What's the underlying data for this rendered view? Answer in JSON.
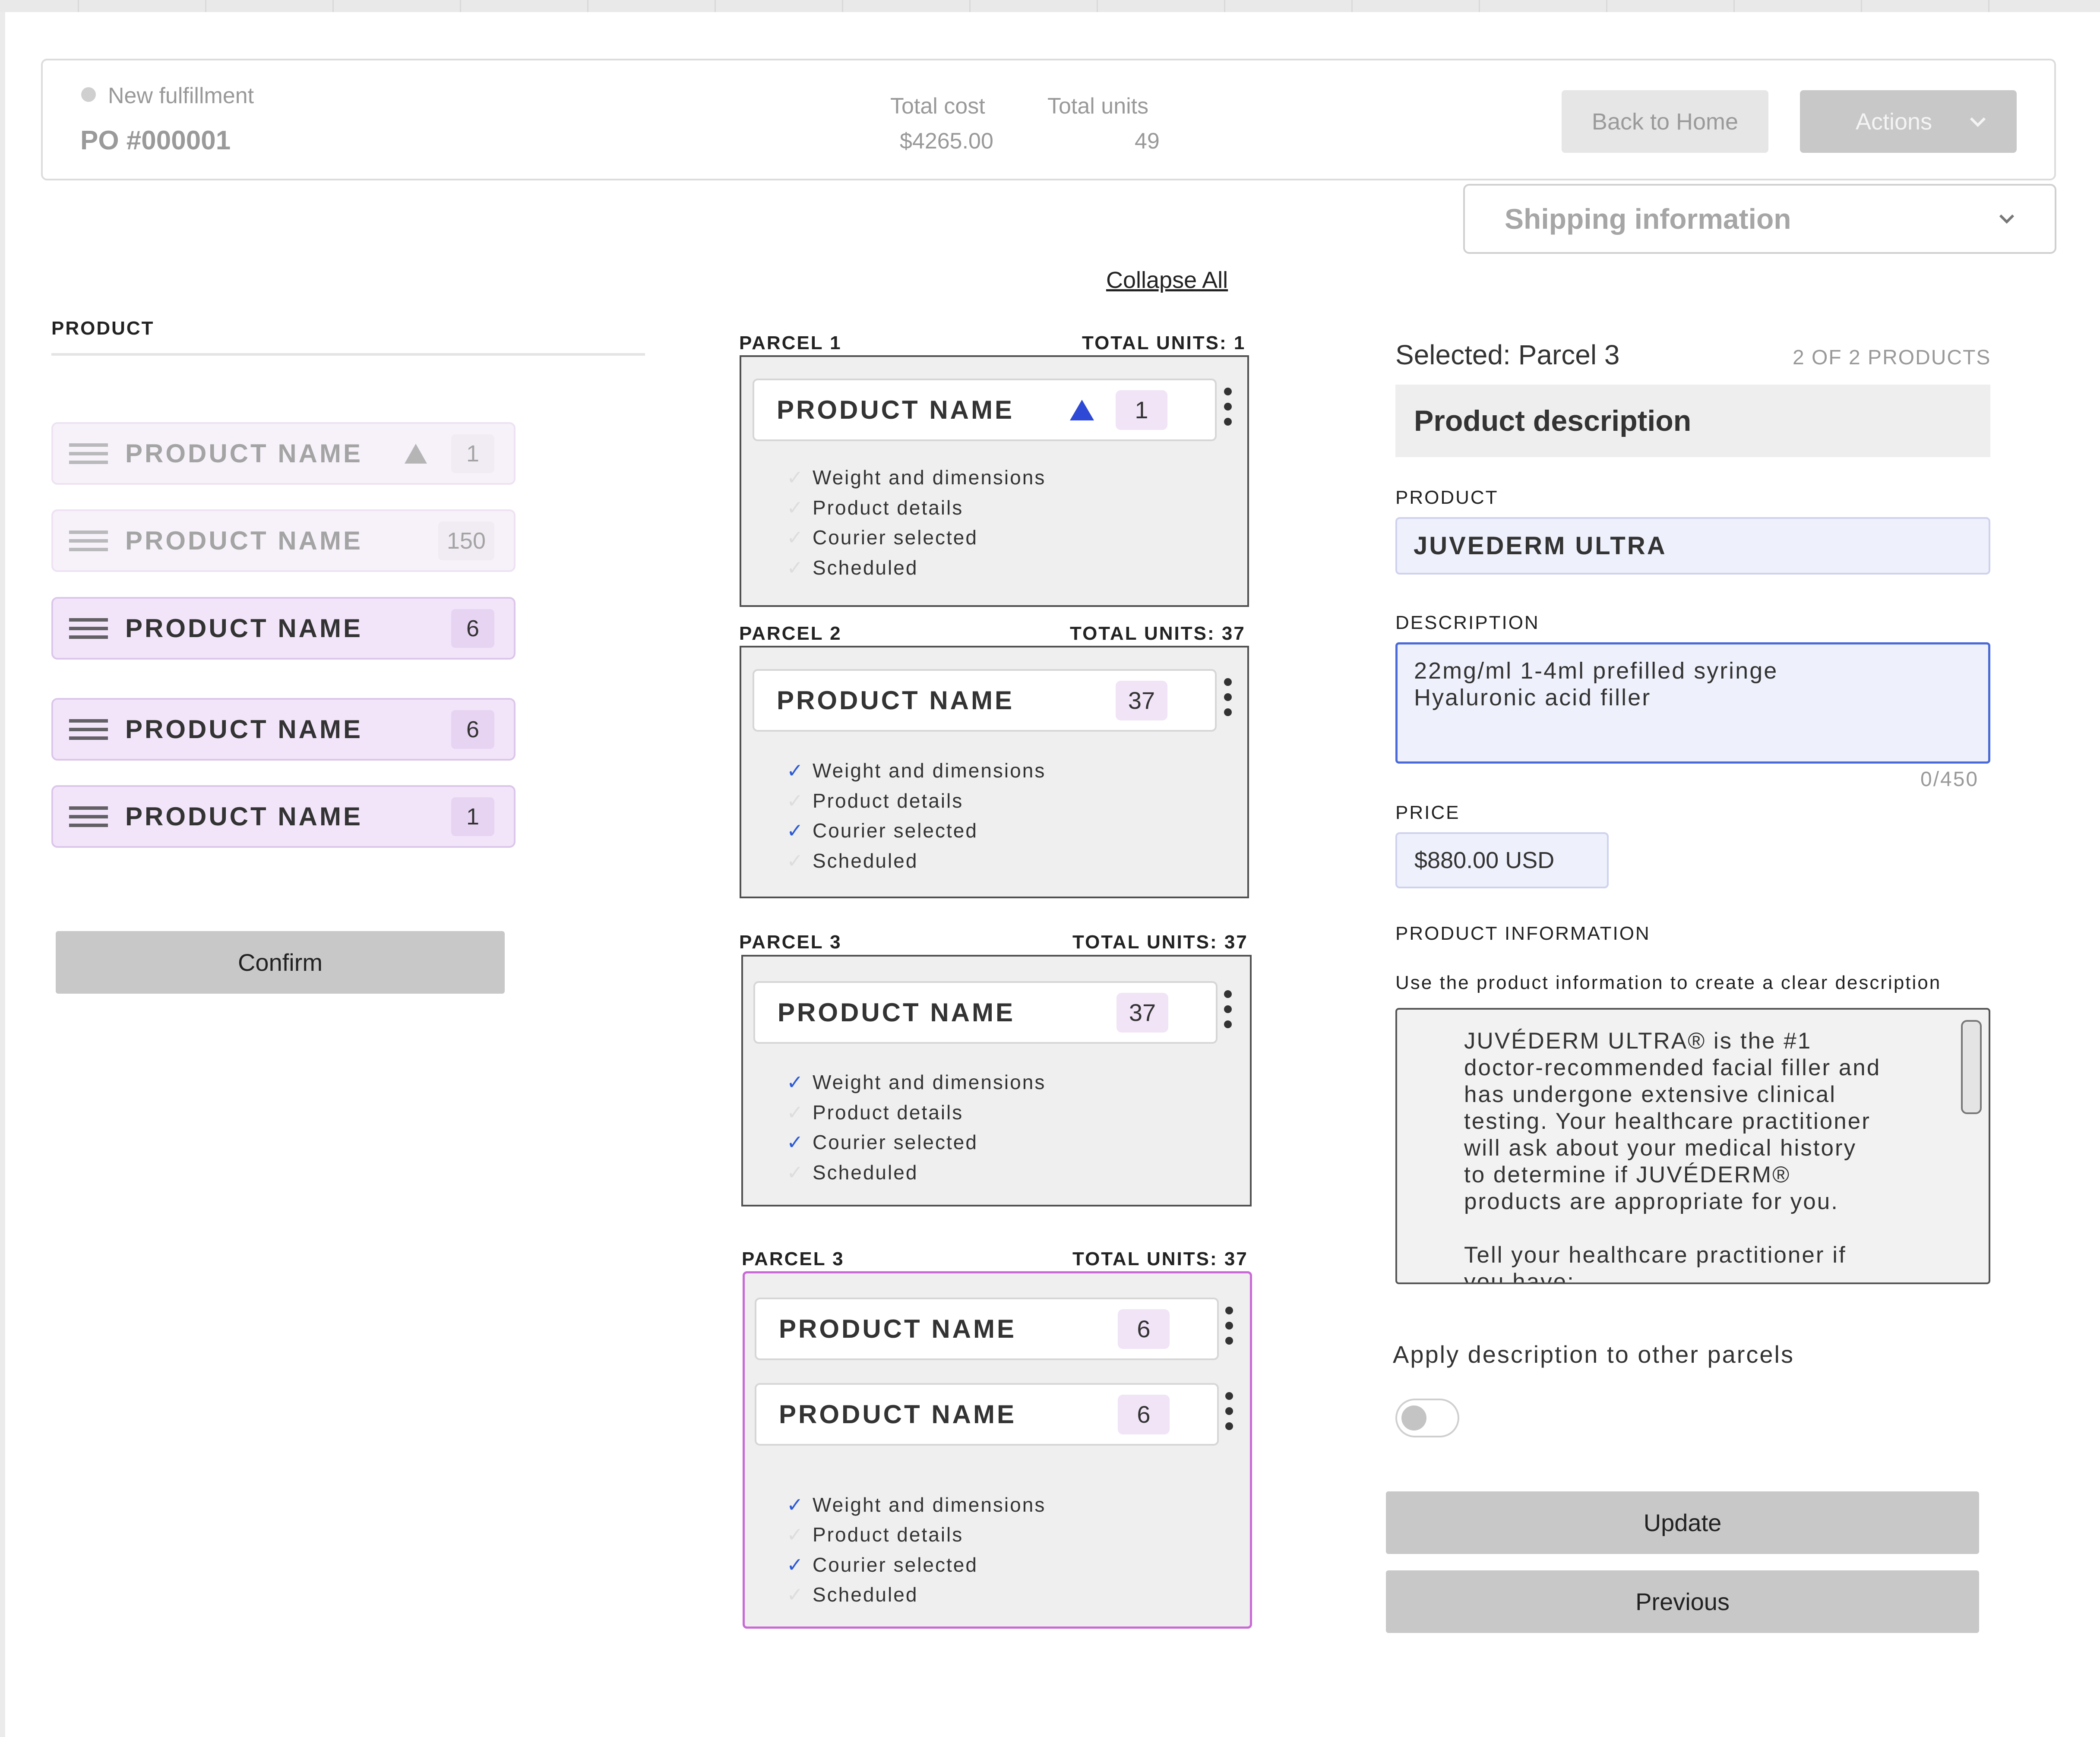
{
  "header": {
    "status": "New fulfillment",
    "po": "PO #000001",
    "total_cost_label": "Total cost",
    "total_cost": "$4265.00",
    "total_units_label": "Total units",
    "total_units": "49",
    "back_button": "Back to Home",
    "actions_button": "Actions"
  },
  "shipping_dropdown": "Shipping information",
  "collapse_all": "Collapse All",
  "product_panel": {
    "heading": "PRODUCT",
    "items": [
      {
        "name": "PRODUCT NAME",
        "count": "1"
      },
      {
        "name": "PRODUCT NAME",
        "count": "150"
      },
      {
        "name": "PRODUCT NAME",
        "count": "6"
      },
      {
        "name": "PRODUCT NAME",
        "count": "6"
      },
      {
        "name": "PRODUCT NAME",
        "count": "1"
      }
    ],
    "confirm": "Confirm"
  },
  "parcels": [
    {
      "title": "PARCEL 1",
      "units": "TOTAL UNITS: 1",
      "items": [
        {
          "name": "PRODUCT NAME",
          "count": "1"
        }
      ],
      "checks": [
        "Weight and dimensions",
        "Product details",
        "Courier selected",
        "Scheduled"
      ]
    },
    {
      "title": "PARCEL 2",
      "units": "TOTAL UNITS: 37",
      "items": [
        {
          "name": "PRODUCT NAME",
          "count": "37"
        }
      ],
      "checks": [
        "Weight and dimensions",
        "Product details",
        "Courier selected",
        "Scheduled"
      ]
    },
    {
      "title": "PARCEL 3",
      "units": "TOTAL UNITS: 37",
      "items": [
        {
          "name": "PRODUCT NAME",
          "count": "37"
        }
      ],
      "checks": [
        "Weight and dimensions",
        "Product details",
        "Courier selected",
        "Scheduled"
      ]
    },
    {
      "title": "PARCEL 3",
      "units": "TOTAL UNITS: 37",
      "items": [
        {
          "name": "PRODUCT NAME",
          "count": "6"
        },
        {
          "name": "PRODUCT NAME",
          "count": "6"
        }
      ],
      "checks": [
        "Weight and dimensions",
        "Product details",
        "Courier selected",
        "Scheduled"
      ]
    }
  ],
  "detail": {
    "selected": "Selected: Parcel 3",
    "count": "2 OF 2 PRODUCTS",
    "section_title": "Product description",
    "product_label": "PRODUCT",
    "product_value": "JUVEDERM ULTRA",
    "description_label": "DESCRIPTION",
    "description_value": "22mg/ml 1-4ml prefilled syringe\nHyaluronic acid filler",
    "char_count": "0/450",
    "price_label": "PRICE",
    "price_value": "$880.00 USD",
    "info_label": "PRODUCT INFORMATION",
    "info_hint": "Use the product information to create a clear description",
    "info_text": "JUVÉDERM ULTRA® is the #1\ndoctor-recommended facial filler and\nhas undergone extensive clinical\ntesting. Your healthcare practitioner\nwill ask about your medical history\nto determine if JUVÉDERM®\nproducts are appropriate for you.\n\nTell your healthcare practitioner if\nyou have:",
    "apply_label": "Apply description to other parcels",
    "update_button": "Update",
    "previous_button": "Previous"
  }
}
